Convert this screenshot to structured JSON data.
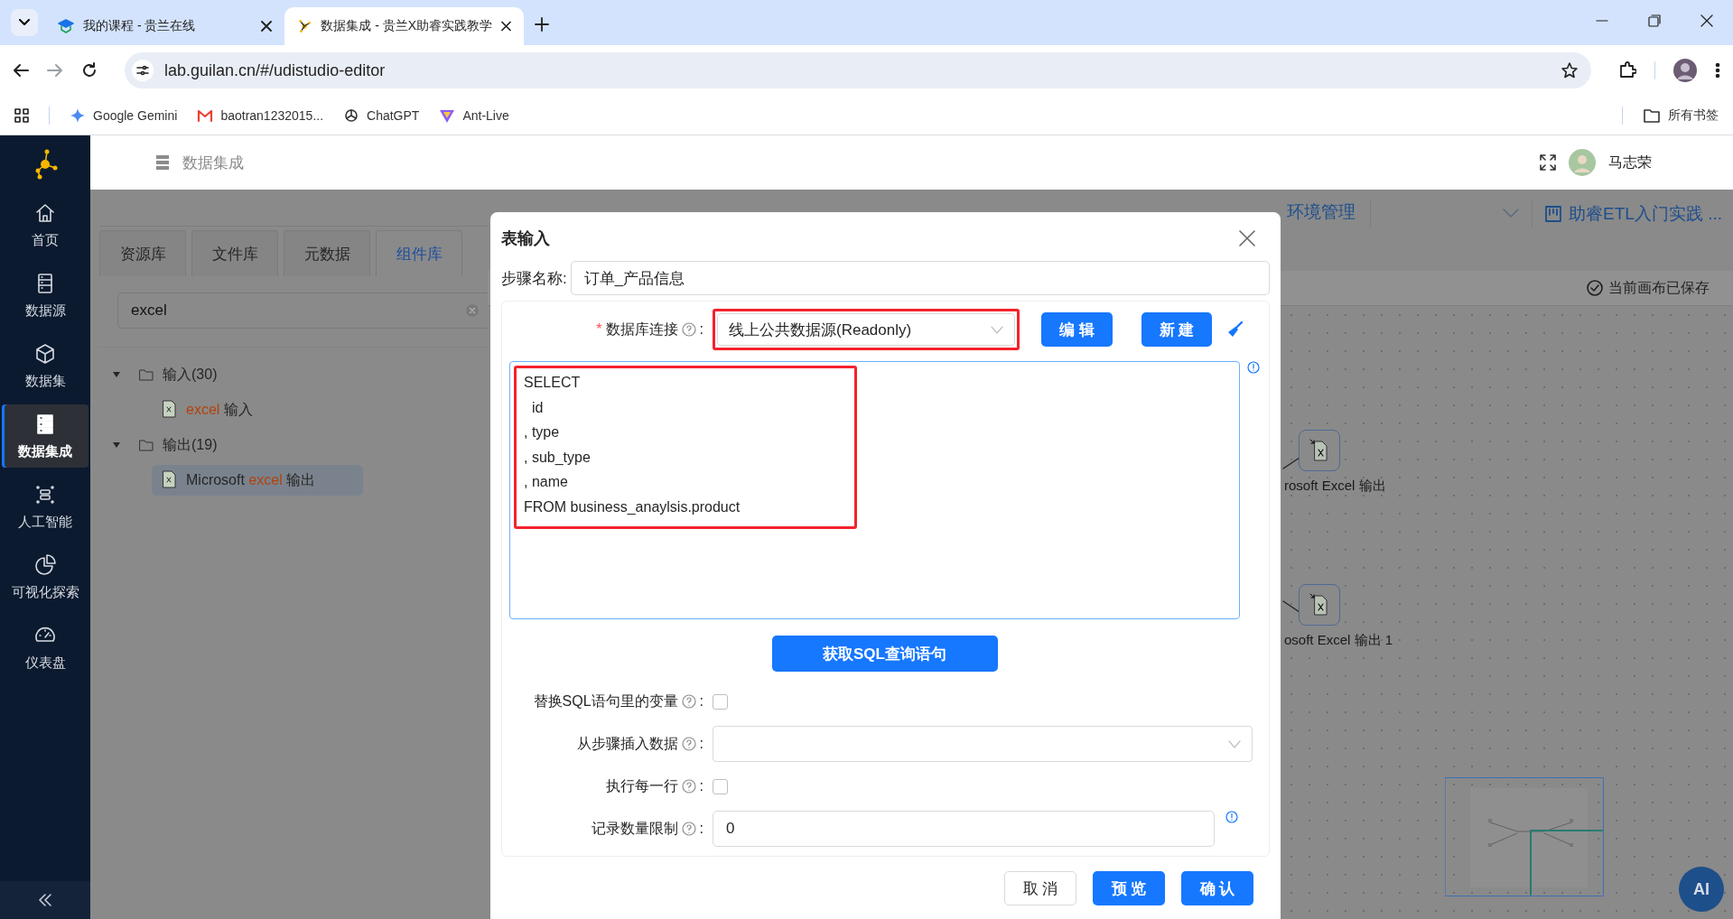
{
  "browser": {
    "tabs": [
      {
        "title": "我的课程 - 贵兰在线",
        "selected": false
      },
      {
        "title": "数据集成 - 贵兰X助睿实践教学",
        "selected": true
      }
    ],
    "url": "lab.guilan.cn/#/udistudio-editor",
    "bookmarks": [
      {
        "label": "Google Gemini",
        "kind": "gemini"
      },
      {
        "label": "baotran1232015...",
        "kind": "mail"
      },
      {
        "label": "ChatGPT",
        "kind": "chat"
      },
      {
        "label": "Ant-Live",
        "kind": "ant"
      }
    ],
    "all_bookmarks": "所有书签"
  },
  "sidebar": {
    "items": [
      {
        "label": "首页",
        "kind": "home",
        "selected": false
      },
      {
        "label": "数据源",
        "kind": "source",
        "selected": false
      },
      {
        "label": "数据集",
        "kind": "cube",
        "selected": false
      },
      {
        "label": "数据集成",
        "kind": "server",
        "selected": true
      },
      {
        "label": "人工智能",
        "kind": "scan",
        "selected": false
      },
      {
        "label": "可视化探索",
        "kind": "pie",
        "selected": false
      },
      {
        "label": "仪表盘",
        "kind": "gauge",
        "selected": false
      }
    ]
  },
  "header": {
    "title": "数据集成",
    "user": "马志荣"
  },
  "panel": {
    "tabs": [
      {
        "label": "资源库",
        "selected": false
      },
      {
        "label": "文件库",
        "selected": false
      },
      {
        "label": "元数据",
        "selected": false
      },
      {
        "label": "组件库",
        "selected": true
      }
    ],
    "search": {
      "value": "excel"
    },
    "tree": [
      {
        "label": "输入(30)",
        "expanded": true,
        "children": [
          {
            "match": "excel",
            "suffix": " 输入",
            "selected": false
          }
        ]
      },
      {
        "label": "输出(19)",
        "expanded": true,
        "children": [
          {
            "prefix": "Microsoft ",
            "match": "excel",
            "suffix": " 输出",
            "selected": true
          }
        ]
      }
    ]
  },
  "toolbar": {
    "nav": "环境管理",
    "project": "助睿ETL入门实践 ...",
    "save_status": "当前画布已保存"
  },
  "canvas": {
    "nodes": [
      {
        "label": "rosoft Excel 输出"
      },
      {
        "label": "osoft Excel 输出 1"
      }
    ]
  },
  "dialog": {
    "title": "表输入",
    "step_name": {
      "label": "步骤名称:",
      "value": "订单_产品信息"
    },
    "connection": {
      "required_mark": "*",
      "label": "数据库连接",
      "colon": ":",
      "value": "线上公共数据源(Readonly)",
      "highlighted": true
    },
    "connection_buttons": [
      "编 辑",
      "新 建"
    ],
    "sql": {
      "text": "SELECT\n  id\n, type\n, sub_type\n, name\nFROM business_anaylsis.product",
      "highlighted": true
    },
    "get_sql_button": "获取SQL查询语句",
    "options": [
      {
        "kind": "checkbox",
        "label": "替换SQL语句里的变量",
        "colon": ":",
        "checked": false
      },
      {
        "kind": "select",
        "label": "从步骤插入数据",
        "colon": ":"
      },
      {
        "kind": "checkbox",
        "label": "执行每一行",
        "colon": ":",
        "checked": false
      },
      {
        "kind": "input",
        "label": "记录数量限制",
        "colon": ":",
        "value": "0"
      }
    ],
    "footer_buttons": [
      {
        "label": "取 消",
        "kind": "default"
      },
      {
        "label": "预 览",
        "kind": "primary"
      },
      {
        "label": "确 认",
        "kind": "primary"
      }
    ]
  },
  "ai_button": "AI"
}
